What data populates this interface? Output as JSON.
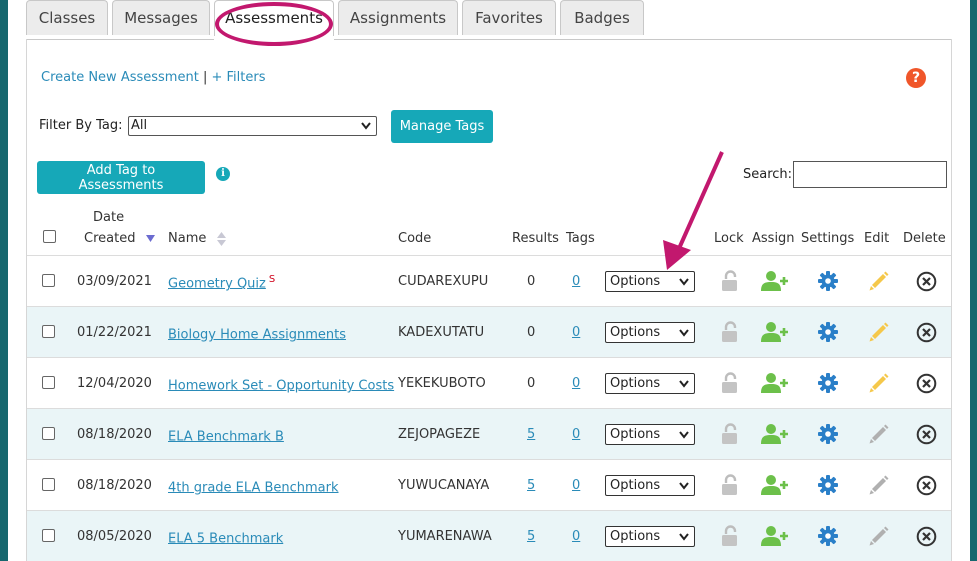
{
  "tabs": [
    {
      "label": "Classes",
      "active": false
    },
    {
      "label": "Messages",
      "active": false
    },
    {
      "label": "Assessments",
      "active": true
    },
    {
      "label": "Assignments",
      "active": false
    },
    {
      "label": "Favorites",
      "active": false
    },
    {
      "label": "Badges",
      "active": false
    }
  ],
  "toolbar": {
    "create_label": "Create New Assessment",
    "separator": "|",
    "filters_label": "+ Filters",
    "help_glyph": "?",
    "filter_by_tag_label": "Filter By Tag:",
    "filter_by_tag_value": "All",
    "manage_tags_label": "Manage Tags",
    "add_tag_label": "Add Tag to Assessments",
    "info_glyph": "i",
    "search_label": "Search:",
    "search_value": ""
  },
  "columns": {
    "date_line1": "Date",
    "date_line2": "Created",
    "name": "Name",
    "code": "Code",
    "results": "Results",
    "tags": "Tags",
    "lock": "Lock",
    "assign": "Assign",
    "settings": "Settings",
    "edit": "Edit",
    "delete": "Delete"
  },
  "rows": [
    {
      "date": "03/09/2021",
      "name": "Geometry Quiz",
      "badge": "S",
      "code": "CUDAREXUPU",
      "results": "0",
      "results_link": false,
      "tags": "0",
      "options": "Options",
      "edit_active": true
    },
    {
      "date": "01/22/2021",
      "name": "Biology Home Assignments",
      "badge": "",
      "code": "KADEXUTATU",
      "results": "0",
      "results_link": false,
      "tags": "0",
      "options": "Options",
      "edit_active": true
    },
    {
      "date": "12/04/2020",
      "name": "Homework Set - Opportunity Costs",
      "badge": "",
      "code": "YEKEKUBOTO",
      "results": "0",
      "results_link": false,
      "tags": "0",
      "options": "Options",
      "edit_active": true
    },
    {
      "date": "08/18/2020",
      "name": "ELA Benchmark B",
      "badge": "",
      "code": "ZEJOPAGEZE",
      "results": "5",
      "results_link": true,
      "tags": "0",
      "options": "Options",
      "edit_active": false
    },
    {
      "date": "08/18/2020",
      "name": "4th grade ELA Benchmark",
      "badge": "",
      "code": "YUWUCANAYA",
      "results": "5",
      "results_link": true,
      "tags": "0",
      "options": "Options",
      "edit_active": false
    },
    {
      "date": "08/05/2020",
      "name": "ELA 5 Benchmark",
      "badge": "",
      "code": "YUMARENAWA",
      "results": "5",
      "results_link": true,
      "tags": "0",
      "options": "Options",
      "edit_active": false
    }
  ],
  "colors": {
    "accent": "#16a8b8",
    "link": "#2a8bb8",
    "annotation": "#c2186e",
    "assign_green": "#6cc04a",
    "settings_blue": "#2a7fc8",
    "edit_yellow": "#f5c84a",
    "edit_gray": "#b0b0b0"
  }
}
